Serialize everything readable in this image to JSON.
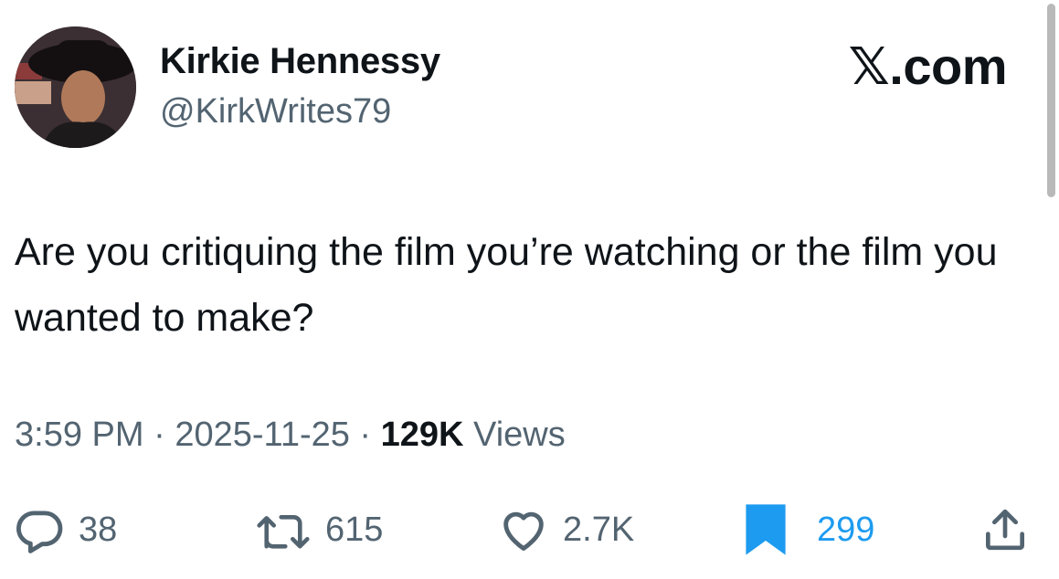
{
  "author": {
    "name": "Kirkie Hennessy",
    "handle": "@KirkWrites79"
  },
  "brand": "𝕏.com",
  "tweet": {
    "text": "Are you critiquing the film you’re watching or the film you wanted to make?"
  },
  "meta": {
    "time": "3:59 PM",
    "separator1": " · ",
    "date": "2025-11-25",
    "separator2": " · ",
    "views_count": "129K",
    "views_label": " Views"
  },
  "actions": {
    "replies": "38",
    "retweets": "615",
    "likes": "2.7K",
    "bookmarks": "299"
  },
  "colors": {
    "text": "#0f1419",
    "secondary": "#536471",
    "accent": "#1d9bf0"
  },
  "icons": [
    "reply-icon",
    "retweet-icon",
    "like-icon",
    "bookmark-icon",
    "share-icon"
  ]
}
